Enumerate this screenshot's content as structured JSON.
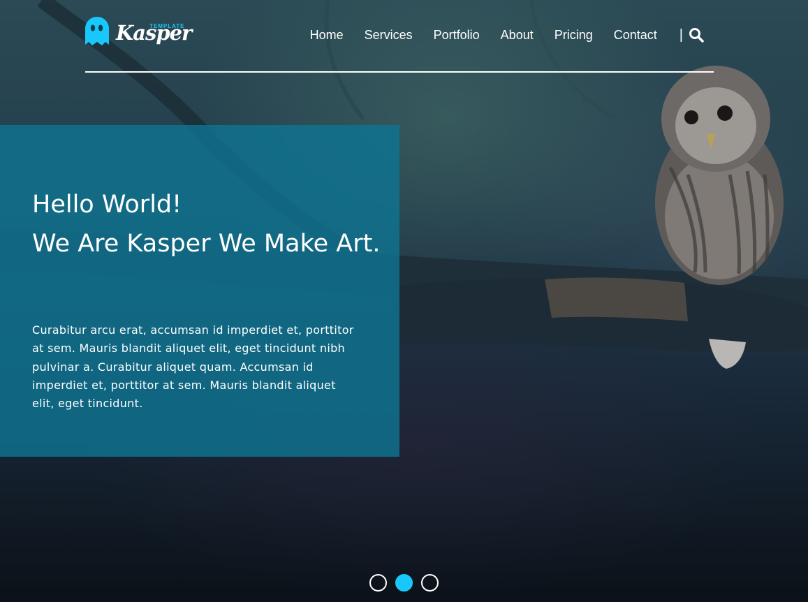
{
  "logo": {
    "wordmark": "Kasper",
    "tag": "TEMPLATE",
    "brand_color": "#19c8fa"
  },
  "nav": {
    "items": [
      {
        "label": "Home"
      },
      {
        "label": "Services"
      },
      {
        "label": "Portfolio"
      },
      {
        "label": "About"
      },
      {
        "label": "Pricing"
      },
      {
        "label": "Contact"
      }
    ],
    "separator": "|",
    "search_icon": "search-icon"
  },
  "hero": {
    "heading_line1": "Hello World!",
    "heading_line2": "We Are Kasper We Make Art.",
    "body": "Curabitur arcu erat, accumsan id imperdiet et, porttitor at sem. Mauris blandit aliquet elit, eget tincidunt nibh pulvinar a. Curabitur aliquet quam. Accumsan id imperdiet et, porttitor at sem. Mauris blandit aliquet elit, eget tincidunt.",
    "panel_color": "#0f7491"
  },
  "slider": {
    "count": 3,
    "active_index": 1
  }
}
